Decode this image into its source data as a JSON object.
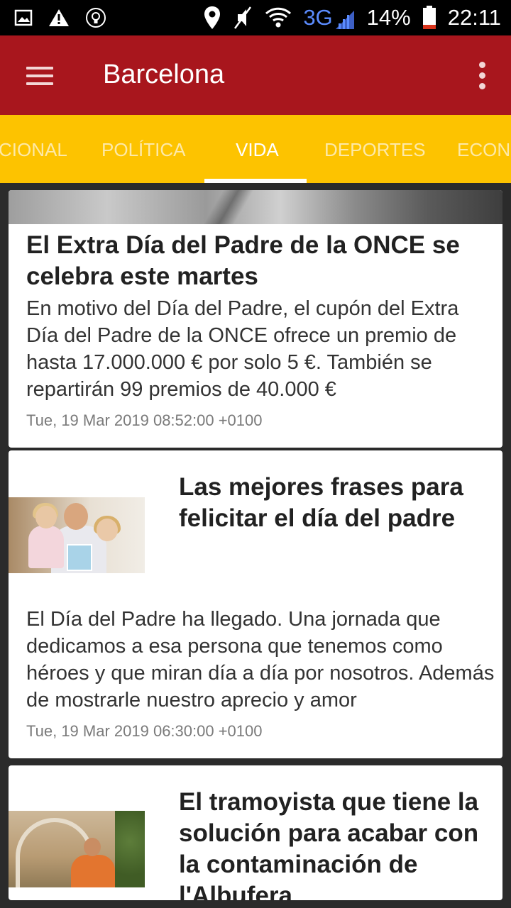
{
  "status_bar": {
    "icons_left": [
      "image-icon",
      "warning-icon",
      "lightbulb-icon"
    ],
    "icons_right": [
      "location-icon",
      "mute-icon",
      "wifi-icon",
      "signal-icon",
      "battery-icon"
    ],
    "network": "3G",
    "battery": "14%",
    "time": "22:11",
    "colors": {
      "network": "#5b8cff",
      "battery_low": "#d9341c"
    }
  },
  "toolbar": {
    "title": "Barcelona",
    "menu_icon": "hamburger-menu-icon",
    "overflow_icon": "more-vert-icon",
    "background": "#a8161d"
  },
  "tabs": {
    "items": [
      {
        "label": "CIONAL",
        "active": false
      },
      {
        "label": "POLÍTICA",
        "active": false
      },
      {
        "label": "VIDA",
        "active": true
      },
      {
        "label": "DEPORTES",
        "active": false
      },
      {
        "label": "ECONO",
        "active": false
      }
    ],
    "background": "#fdc300"
  },
  "articles": [
    {
      "title": "El Extra Día del Padre de la ONCE se celebra este martes",
      "description": "En motivo del Día del Padre, el cupón del Extra Día del Padre de la ONCE ofrece un premio de hasta 17.000.000 € por solo 5 €. También se repartirán 99 premios de 40.000 €",
      "date": "Tue, 19 Mar 2019 08:52:00 +0100"
    },
    {
      "title": "Las mejores frases para felicitar el día del padre",
      "description": "El Día del Padre ha llegado. Una jornada que dedicamos a esa persona que tenemos como héroes y que miran día a día por nosotros. Además de mostrarle nuestro aprecio y amor",
      "date": "Tue, 19 Mar 2019 06:30:00 +0100"
    },
    {
      "title": "El tramoyista que tiene la solución para acabar con la contaminación de l'Albufera",
      "description": "",
      "date": ""
    }
  ]
}
